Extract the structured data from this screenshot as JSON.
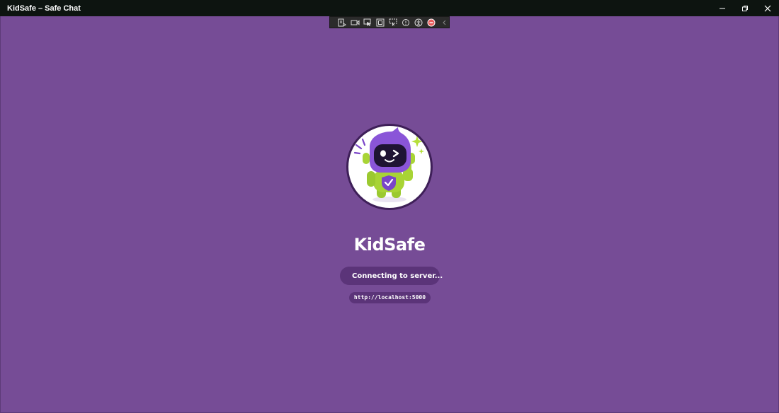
{
  "window": {
    "title": "KidSafe – Safe Chat",
    "controls": [
      "minimize-icon",
      "restore-icon",
      "close-icon"
    ]
  },
  "dev_toolbar": {
    "icons": [
      "live-visual-tree-icon",
      "record-icon",
      "select-element-icon",
      "display-layout-adorners-icon",
      "track-focus-icon",
      "binding-failures-icon",
      "accessibility-icon",
      "hot-reload-status-icon",
      "collapse-chevron-icon"
    ]
  },
  "splash": {
    "app_name": "KidSafe",
    "status_text": "Connecting to server...",
    "server_url": "http://localhost:5000",
    "mascot": "robot-mascot-icon"
  },
  "colors": {
    "background": "#764c96",
    "pill": "#5b3479",
    "titlebar": "#0d1410",
    "mascot_purple": "#8a55d8",
    "mascot_green": "#a8d435"
  }
}
